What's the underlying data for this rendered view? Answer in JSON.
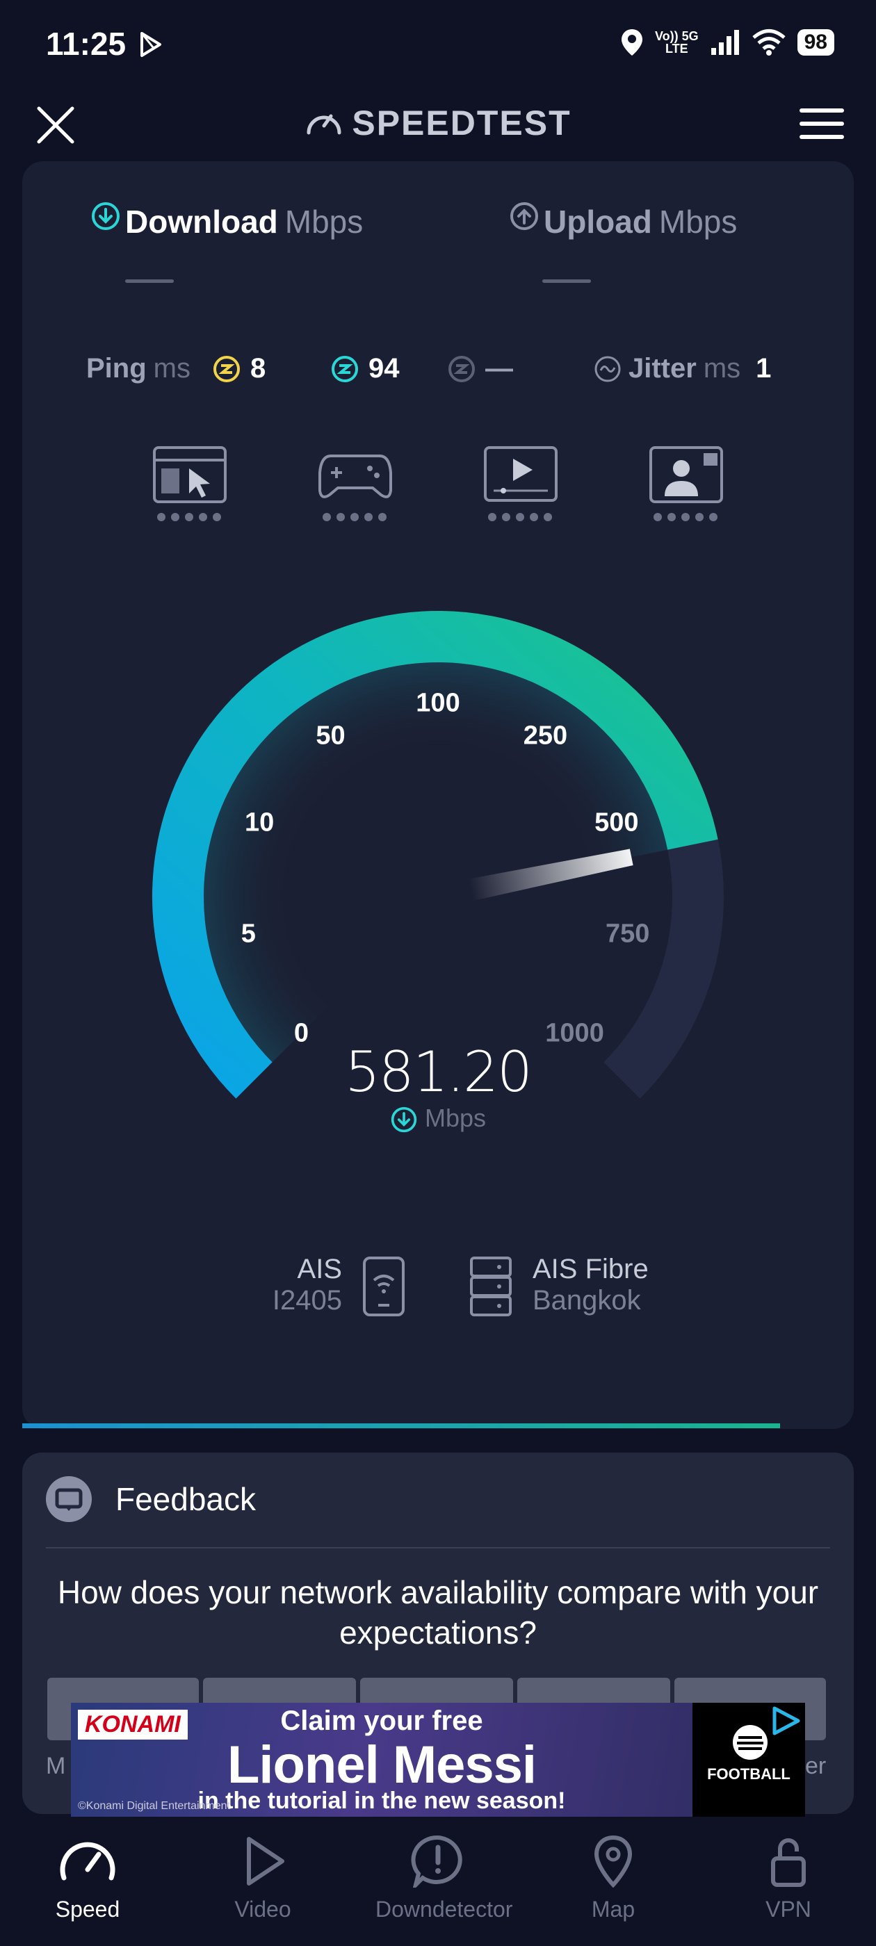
{
  "status_bar": {
    "time": "11:25",
    "network_top": "Vo)) 5G",
    "network_bottom": "LTE",
    "battery": "98"
  },
  "header": {
    "title": "SPEEDTEST"
  },
  "tabs": [
    {
      "label": "Download",
      "unit": "Mbps"
    },
    {
      "label": "Upload",
      "unit": "Mbps"
    }
  ],
  "metrics": {
    "ping_label": "Ping",
    "ping_unit": "ms",
    "ping_idle": "8",
    "ping_download": "94",
    "ping_upload": "—",
    "jitter_label": "Jitter",
    "jitter_unit": "ms",
    "jitter_value": "1"
  },
  "gauge": {
    "ticks": [
      "0",
      "5",
      "10",
      "50",
      "100",
      "250",
      "500",
      "750",
      "1000"
    ],
    "value": "581.20",
    "unit": "Mbps",
    "colors": {
      "start": "#0aa4e8",
      "end": "#1bc48c",
      "track": "#242a44"
    }
  },
  "isp": {
    "provider": "AIS",
    "provider_sub": "I2405",
    "server": "AIS Fibre",
    "server_sub": "Bangkok"
  },
  "feedback": {
    "title": "Feedback",
    "question": "How does your network availability compare with your expectations?",
    "left_edge": "M",
    "right_edge": "er"
  },
  "ad": {
    "brand": "KONAMI",
    "line1": "Claim your free",
    "line2": "Lionel Messi",
    "line3": "in the tutorial in the new season!",
    "copyright": "©Konami Digital Entertainment",
    "side": "FOOTBALL"
  },
  "nav": [
    {
      "label": "Speed",
      "icon": "speed-icon"
    },
    {
      "label": "Video",
      "icon": "video-icon"
    },
    {
      "label": "Downdetector",
      "icon": "downdetector-icon"
    },
    {
      "label": "Map",
      "icon": "map-icon"
    },
    {
      "label": "VPN",
      "icon": "vpn-icon"
    }
  ]
}
